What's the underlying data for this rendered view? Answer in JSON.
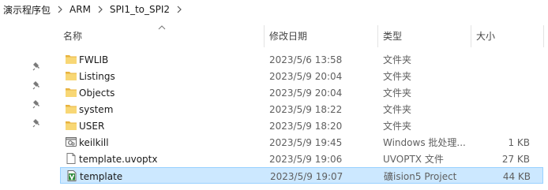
{
  "breadcrumb": [
    "演示程序包",
    "ARM",
    "SPI1_to_SPI2"
  ],
  "columns": {
    "name": "名称",
    "date": "修改日期",
    "type": "类型",
    "size": "大小"
  },
  "sort": {
    "column": "name",
    "direction": "ascending"
  },
  "pinned_count": 4,
  "files": [
    {
      "name": "FWLIB",
      "date": "2023/5/6 13:58",
      "type": "文件夹",
      "size": "",
      "icon": "folder-icon"
    },
    {
      "name": "Listings",
      "date": "2023/5/9 20:04",
      "type": "文件夹",
      "size": "",
      "icon": "folder-icon"
    },
    {
      "name": "Objects",
      "date": "2023/5/9 20:04",
      "type": "文件夹",
      "size": "",
      "icon": "folder-icon"
    },
    {
      "name": "system",
      "date": "2023/5/9 18:22",
      "type": "文件夹",
      "size": "",
      "icon": "folder-icon"
    },
    {
      "name": "USER",
      "date": "2023/5/9 18:20",
      "type": "文件夹",
      "size": "",
      "icon": "folder-icon"
    },
    {
      "name": "keilkill",
      "date": "2023/5/9 19:45",
      "type": "Windows 批处理...",
      "size": "1 KB",
      "icon": "batch-file-icon"
    },
    {
      "name": "template.uvoptx",
      "date": "2023/5/9 19:06",
      "type": "UVOPTX 文件",
      "size": "27 KB",
      "icon": "document-icon"
    },
    {
      "name": "template",
      "date": "2023/5/9 19:07",
      "type": "礦ision5 Project",
      "size": "44 KB",
      "icon": "keil-project-icon",
      "selected": true
    }
  ],
  "colors": {
    "folder": "#f8d775",
    "folder_dark": "#e8b33f",
    "selection_bg": "#cce8ff",
    "selection_border": "#99d1ff",
    "keil_green": "#2e8b3a"
  }
}
